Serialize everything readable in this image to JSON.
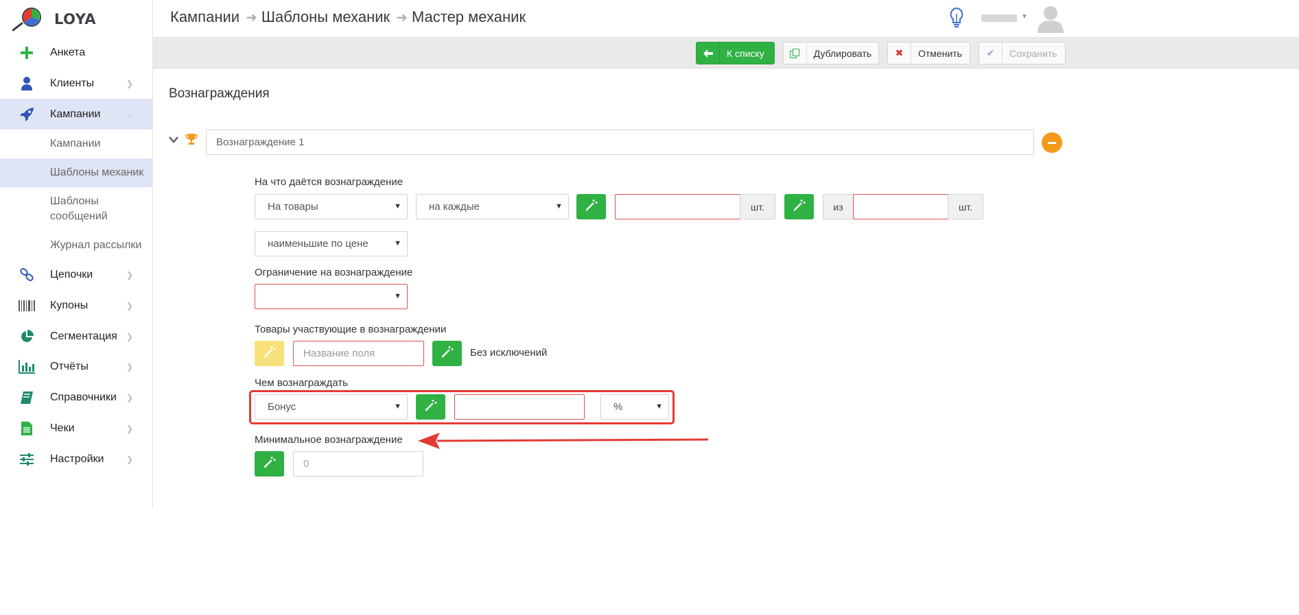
{
  "app": {
    "name": "LOYA"
  },
  "sidebar": {
    "items": [
      {
        "label": "Анкета",
        "icon": "plus-icon",
        "has_chevron": false
      },
      {
        "label": "Клиенты",
        "icon": "user-icon",
        "has_chevron": true
      },
      {
        "label": "Кампании",
        "icon": "rocket-icon",
        "has_chevron": true,
        "active": true
      },
      {
        "label": "Цепочки",
        "icon": "chain-icon",
        "has_chevron": true
      },
      {
        "label": "Купоны",
        "icon": "barcode-icon",
        "has_chevron": true
      },
      {
        "label": "Сегментация",
        "icon": "pie-chart-icon",
        "has_chevron": true
      },
      {
        "label": "Отчёты",
        "icon": "bar-chart-icon",
        "has_chevron": true
      },
      {
        "label": "Справочники",
        "icon": "book-icon",
        "has_chevron": true
      },
      {
        "label": "Чеки",
        "icon": "receipt-icon",
        "has_chevron": true
      },
      {
        "label": "Настройки",
        "icon": "sliders-icon",
        "has_chevron": true
      }
    ],
    "campaign_subitems": [
      {
        "label": "Кампании"
      },
      {
        "label": "Шаблоны механик",
        "active": true
      },
      {
        "label": "Шаблоны сообщений"
      },
      {
        "label": "Журнал рассылки"
      }
    ]
  },
  "header": {
    "breadcrumb": [
      "Кампании",
      "Шаблоны механик",
      "Мастер механик"
    ]
  },
  "toolbar": {
    "back_label": "К списку",
    "duplicate_label": "Дублировать",
    "cancel_label": "Отменить",
    "save_label": "Сохранить"
  },
  "main": {
    "section_title": "Вознаграждения",
    "reward": {
      "name": "Вознаграждение 1",
      "for_what_label": "На что даётся вознаграждение",
      "target_select": "На товары",
      "every_select": "на каждые",
      "unit_1": "шт.",
      "from_label": "из",
      "unit_2": "шт.",
      "cheapest_select": "наименьшие по цене",
      "limit_label": "Ограничение на вознаграждение",
      "limit_select": "",
      "goods_label": "Товары участвующие в вознаграждении",
      "field_name_placeholder": "Название поля",
      "no_exceptions": "Без исключений",
      "reward_with_label": "Чем вознаграждать",
      "reward_type_select": "Бонус",
      "reward_unit_select": "%",
      "min_reward_label": "Минимальное вознаграждение",
      "min_reward_placeholder": "0"
    }
  },
  "colors": {
    "accent_green": "#2fb144",
    "orange": "#f39a1b",
    "error_red": "#d9534f",
    "highlight_red": "#e33a35",
    "active_nav_bg": "#dfe5f5"
  }
}
